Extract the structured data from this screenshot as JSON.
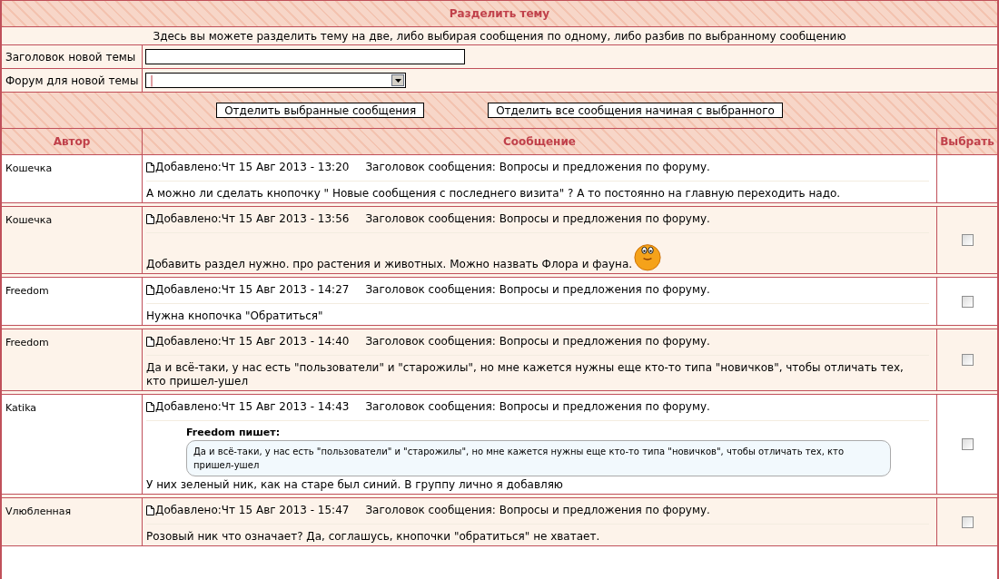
{
  "title": "Разделить тему",
  "description": "Здесь вы можете разделить тему на две, либо выбирая сообщения по одному, либо разбив по выбранному сообщению",
  "fields": [
    {
      "label": "Заголовок новой темы",
      "kind": "text"
    },
    {
      "label": "Форум для новой темы",
      "kind": "select",
      "value": "|"
    }
  ],
  "buttons": [
    "Отделить выбранные сообщения",
    "Отделить все сообщения начиная с выбранного"
  ],
  "columns": [
    "Автор",
    "Сообщение",
    "Выбрать"
  ],
  "posts": [
    {
      "author": "Кошечка",
      "added": "Добавлено:Чт 15 Авг 2013 - 13:20",
      "subject": "Заголовок сообщения: Вопросы и предложения по форуму.",
      "body": [
        {
          "kind": "text",
          "text": "А можно ли сделать кнопочку \" Новые сообщения с последнего визита\" ? А то постоянно на главную переходить надо."
        }
      ]
    },
    {
      "author": "Кошечка",
      "added": "Добавлено:Чт 15 Авг 2013 - 13:56",
      "subject": "Заголовок сообщения: Вопросы и предложения по форуму.",
      "checked": false,
      "body": [
        {
          "kind": "smiley_text",
          "text": "Добавить раздел нужно. про растения и животных. Можно назвать Флора и фауна."
        }
      ]
    },
    {
      "author": "Freedom",
      "added": "Добавлено:Чт 15 Авг 2013 - 14:27",
      "subject": "Заголовок сообщения: Вопросы и предложения по форуму.",
      "checked": false,
      "body": [
        {
          "kind": "text",
          "text": "Нужна кнопочка \"Обратиться\""
        }
      ]
    },
    {
      "author": "Freedom",
      "added": "Добавлено:Чт 15 Авг 2013 - 14:40",
      "subject": "Заголовок сообщения: Вопросы и предложения по форуму.",
      "checked": false,
      "body": [
        {
          "kind": "text",
          "text": "Да и всё-таки, у нас есть \"пользователи\" и \"старожилы\", но мне кажется нужны еще кто-то типа \"новичков\", чтобы отличать тех, кто пришел-ушел"
        }
      ]
    },
    {
      "author": "Katika",
      "added": "Добавлено:Чт 15 Авг 2013 - 14:43",
      "subject": "Заголовок сообщения: Вопросы и предложения по форуму.",
      "checked": false,
      "body": [
        {
          "kind": "quote",
          "who": "Freedom пишет:",
          "text": "Да и всё-таки, у нас есть \"пользователи\" и \"старожилы\", но мне кажется нужны еще кто-то типа \"новичков\", чтобы отличать тех, кто пришел-ушел"
        },
        {
          "kind": "text",
          "text": "У них зеленый ник, как на старе был синий. В группу лично я добавляю"
        }
      ]
    },
    {
      "author": "Vлюбленная",
      "added": "Добавлено:Чт 15 Авг 2013 - 15:47",
      "subject": "Заголовок сообщения: Вопросы и предложения по форуму.",
      "checked": false,
      "body": [
        {
          "kind": "text",
          "text": "Розовый ник что означает? Да, соглашусь, кнопочки \"обратиться\" не хватает."
        }
      ]
    }
  ]
}
